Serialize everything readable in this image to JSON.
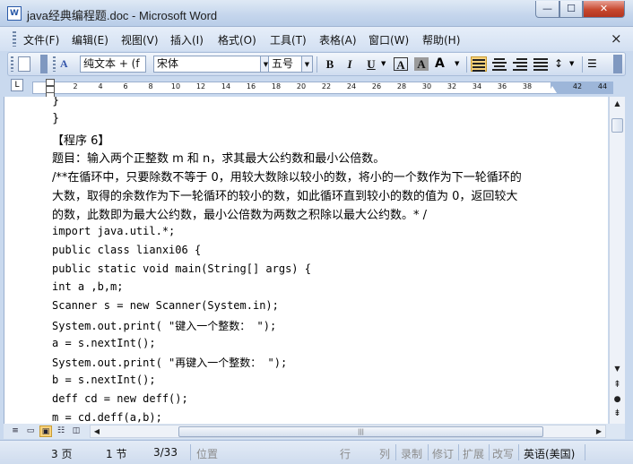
{
  "window": {
    "title": "java经典编程题.doc - Microsoft Word",
    "app_icon_letter": "W",
    "min": "—",
    "max": "☐",
    "close": "✕"
  },
  "menu": {
    "items": [
      "文件(F)",
      "编辑(E)",
      "视图(V)",
      "插入(I)",
      "格式(O)",
      "工具(T)",
      "表格(A)",
      "窗口(W)",
      "帮助(H)"
    ],
    "close_doc": "×"
  },
  "toolbar": {
    "style": "纯文本 + (f",
    "font": "宋体",
    "size": "五号",
    "bold": "B",
    "italic": "I",
    "underline": "U",
    "char_border": "A",
    "char_shading": "A"
  },
  "ruler": {
    "corner": "L",
    "ticks": [
      "2",
      "4",
      "6",
      "8",
      "10",
      "12",
      "14",
      "16",
      "18",
      "20",
      "22",
      "24",
      "26",
      "28",
      "30",
      "32",
      "34",
      "36",
      "38",
      "42",
      "44"
    ]
  },
  "document": {
    "lines": [
      {
        "text": "}",
        "code": false
      },
      {
        "text": "}",
        "code": false
      },
      {
        "text": "【程序 6】",
        "code": false
      },
      {
        "text": "题目：输入两个正整数 m 和 n，求其最大公约数和最小公倍数。",
        "code": false
      },
      {
        "text": "/**在循环中，只要除数不等于 0，用较大数除以较小的数，将小的一个数作为下一轮循环的",
        "code": false
      },
      {
        "text": "大数，取得的余数作为下一轮循环的较小的数，如此循环直到较小的数的值为 0，返回较大",
        "code": false
      },
      {
        "text": "的数，此数即为最大公约数，最小公倍数为两数之积除以最大公约数。* /",
        "code": false
      },
      {
        "text": "import java.util.*;",
        "code": true
      },
      {
        "text": "public    class     lianxi06     {",
        "code": true
      },
      {
        "text": "public static void main(String[] args) {",
        "code": true
      },
      {
        "text": "int     a ,b,m;",
        "code": true
      },
      {
        "text": "Scanner s = new Scanner(System.in);",
        "code": true
      },
      {
        "text": "System.out.print( \"键入一个整数： \");",
        "code": true
      },
      {
        "text": "a = s.nextInt();",
        "code": true
      },
      {
        "text": "System.out.print( \"再键入一个整数： \");",
        "code": true
      },
      {
        "text": "b = s.nextInt();",
        "code": true
      },
      {
        "text": "     deff cd = new deff();",
        "code": true
      },
      {
        "text": "     m = cd.deff(a,b);",
        "code": true
      }
    ]
  },
  "scroll": {
    "up": "▲",
    "down": "▼",
    "hthumb_grip": "|||"
  },
  "status": {
    "page": "3 页",
    "section": "1 节",
    "page_of": "3/33",
    "position": "位置",
    "line": "行",
    "column": "列",
    "record": "录制",
    "revise": "修订",
    "extend": "扩展",
    "overtype": "改写",
    "language": "英语(美国)"
  },
  "colors": {
    "titlebar": "#c4d5ec",
    "close_button": "#c7472e",
    "active_align": "#f8d27c"
  }
}
